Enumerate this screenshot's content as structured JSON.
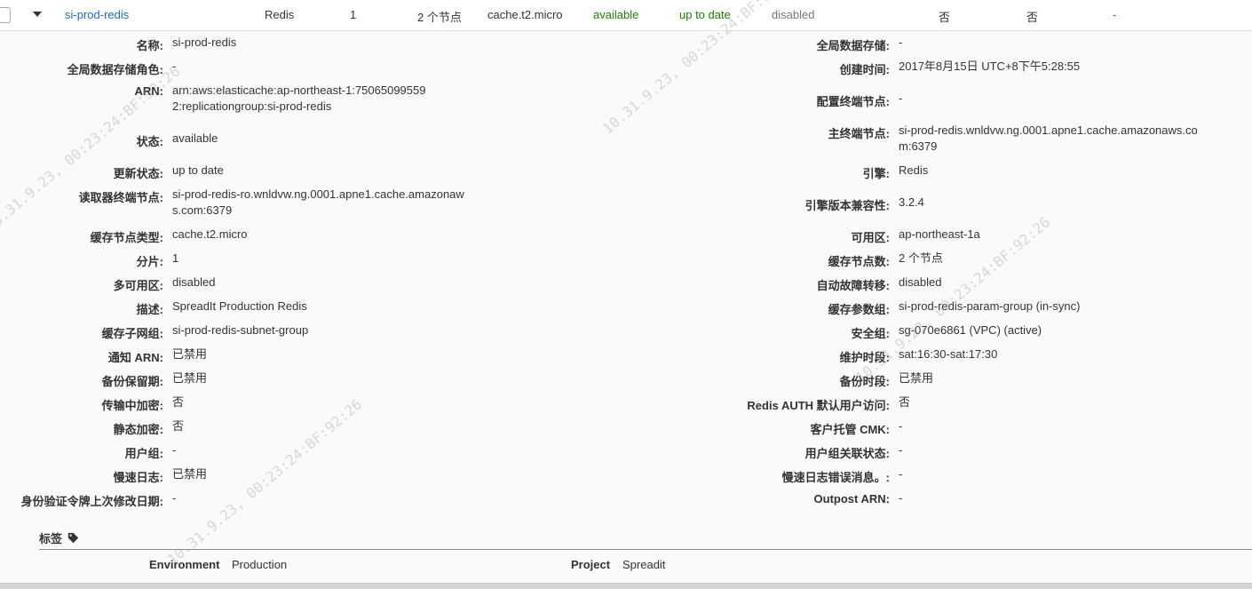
{
  "summary": {
    "name": "si-prod-redis",
    "engine": "Redis",
    "shards": "1",
    "nodes": "2 个节点",
    "node_type": "cache.t2.micro",
    "status": "available",
    "update_status": "up to date",
    "multi_az": "disabled",
    "encryption_in_transit": "否",
    "encryption_at_rest": "否",
    "last_col": "-"
  },
  "details_left": [
    {
      "label": "名称:",
      "value": "si-prod-redis"
    },
    {
      "label": "全局数据存储角色:",
      "value": "-"
    },
    {
      "label": "ARN:",
      "value": "arn:aws:elasticache:ap-northeast-1:750650995592:replicationgroup:si-prod-redis"
    },
    {
      "label": "状态:",
      "value": "available"
    },
    {
      "label": "更新状态:",
      "value": "up to date"
    },
    {
      "label": "读取器终端节点:",
      "value": "si-prod-redis-ro.wnldvw.ng.0001.apne1.cache.amazonaws.com:6379"
    },
    {
      "label": "缓存节点类型:",
      "value": "cache.t2.micro"
    },
    {
      "label": "分片:",
      "value": "1"
    },
    {
      "label": "多可用区:",
      "value": "disabled"
    },
    {
      "label": "描述:",
      "value": "SpreadIt Production Redis"
    },
    {
      "label": "缓存子网组:",
      "value": "si-prod-redis-subnet-group"
    },
    {
      "label": "通知 ARN:",
      "value": "已禁用"
    },
    {
      "label": "备份保留期:",
      "value": "已禁用"
    },
    {
      "label": "传输中加密:",
      "value": "否"
    },
    {
      "label": "静态加密:",
      "value": "否"
    },
    {
      "label": "用户组:",
      "value": "-"
    },
    {
      "label": "慢速日志:",
      "value": "已禁用"
    },
    {
      "label": "身份验证令牌上次修改日期:",
      "value": "-"
    }
  ],
  "details_right": [
    {
      "label": "全局数据存储:",
      "value": "-"
    },
    {
      "label": "创建时间:",
      "value": "2017年8月15日 UTC+8下午5:28:55"
    },
    {
      "label": "配置终端节点:",
      "value": "-"
    },
    {
      "label": "主终端节点:",
      "value": "si-prod-redis.wnldvw.ng.0001.apne1.cache.amazonaws.com:6379"
    },
    {
      "label": "引擎:",
      "value": "Redis"
    },
    {
      "label": "引擎版本兼容性:",
      "value": "3.2.4"
    },
    {
      "label": "可用区:",
      "value": "ap-northeast-1a"
    },
    {
      "label": "缓存节点数:",
      "value": "2 个节点"
    },
    {
      "label": "自动故障转移:",
      "value": "disabled"
    },
    {
      "label": "缓存参数组:",
      "value": "si-prod-redis-param-group (in-sync)"
    },
    {
      "label": "安全组:",
      "value": "sg-070e6861 (VPC) (active)"
    },
    {
      "label": "维护时段:",
      "value": "sat:16:30-sat:17:30"
    },
    {
      "label": "备份时段:",
      "value": "已禁用"
    },
    {
      "label": "Redis AUTH 默认用户访问:",
      "value": "否"
    },
    {
      "label": "客户托管 CMK:",
      "value": "-"
    },
    {
      "label": "用户组关联状态:",
      "value": "-"
    },
    {
      "label": "慢速日志错误消息。:",
      "value": "-"
    },
    {
      "label": "Outpost ARN:",
      "value": "-"
    }
  ],
  "tags": {
    "header": "标签",
    "items": [
      {
        "key": "Environment",
        "value": "Production"
      },
      {
        "key": "Project",
        "value": "Spreadit"
      }
    ]
  },
  "watermark": "10.31.9.23, 00:23:24:BF:92:26",
  "colors": {
    "link": "#1a6ac3",
    "status_green": "#1d8102",
    "muted": "#777777"
  },
  "icons": {
    "expand": "caret-down-icon",
    "tag": "tag-icon"
  }
}
